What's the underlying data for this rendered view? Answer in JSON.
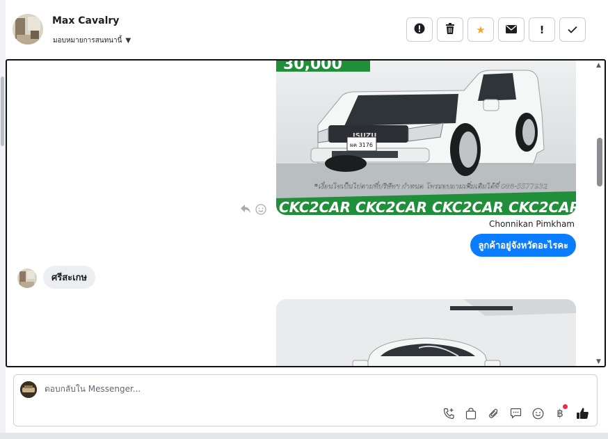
{
  "header": {
    "contact_name": "Max Cavalry",
    "assign_label": "มอบหมายการสนทนานี้",
    "actions": [
      {
        "name": "spam-button",
        "icon": "alert-circle-icon"
      },
      {
        "name": "delete-button",
        "icon": "trash-icon"
      },
      {
        "name": "star-button",
        "icon": "star-icon"
      },
      {
        "name": "mark-unread-button",
        "icon": "envelope-icon"
      },
      {
        "name": "follow-up-button",
        "icon": "exclamation-icon"
      },
      {
        "name": "done-button",
        "icon": "check-icon"
      }
    ]
  },
  "conversation": {
    "image1_caption": "*เงื่อนไขเป็นไปตามที่บริษัทฯ กำหนด โทรสอบถามเพิ่มเติมได้ที่ 088-5577932",
    "image1_banner": "CKC2CAR CKC2CAR CKC2CAR CKC2CAR CKC2CAR CKC2",
    "image1_price": "30,000",
    "image1_plate": "ผค 3176",
    "image1_brand": "ISUZU",
    "sender_name": "Chonnikan Pimkham",
    "outgoing_message": "ลูกค้าอยู่จังหวัดอะไรคะ",
    "incoming_message": "ศรีสะเกษ"
  },
  "composer": {
    "placeholder": "ตอบกลับใน Messenger...",
    "tools": [
      "phone-add-icon",
      "shopping-bag-icon",
      "paperclip-icon",
      "chat-bubble-icon",
      "emoji-icon",
      "baht-icon",
      "thumbs-up-icon"
    ]
  },
  "colors": {
    "accent_blue": "#0a7cff",
    "star_orange": "#f5a623",
    "banner_green": "#1f8f3a",
    "notification_red": "#f02849"
  }
}
